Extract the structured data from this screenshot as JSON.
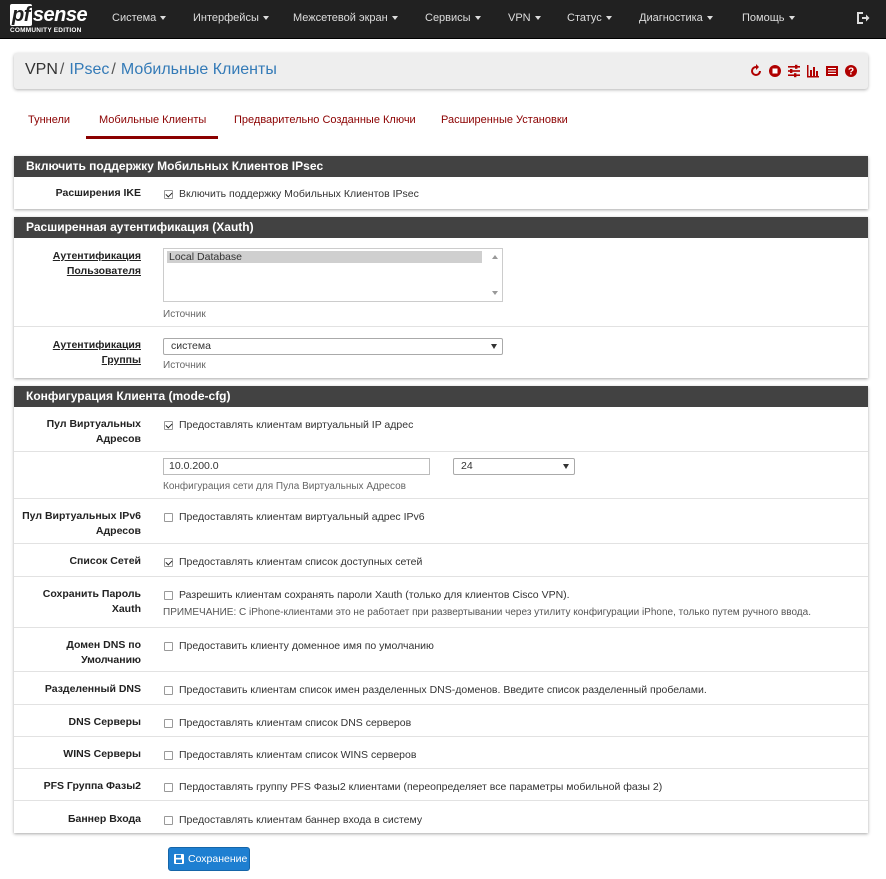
{
  "app": {
    "logo_main": "sense",
    "logo_prefix": "pf",
    "logo_sub": "COMMUNITY EDITION"
  },
  "nav": {
    "items": [
      "Система",
      "Интерфейсы",
      "Межсетевой экран",
      "Сервисы",
      "VPN",
      "Статус",
      "Диагностика",
      "Помощь"
    ]
  },
  "breadcrumb": {
    "root": "VPN",
    "sep": "/",
    "level1": "IPsec",
    "level2": "Мобильные Клиенты"
  },
  "header_icons": [
    "restart-icon",
    "settings-sliders-icon",
    "chart-icon",
    "log-icon",
    "help-icon"
  ],
  "colors": {
    "navbar": "#212121",
    "panel_heading": "#424242",
    "tab_accent": "#8b0000",
    "link": "#337ab7",
    "save_button": "#1e7fd1",
    "header_icon": "#b00000"
  },
  "tabs": {
    "tunnels": "Туннели",
    "mobile": "Мобильные Клиенты",
    "keys": "Предварительно Созданные Ключи",
    "advanced": "Расширенные Установки"
  },
  "section1": {
    "title": "Включить поддержку Мобильных Клиентов IPsec",
    "ike_label": "Расширения IKE",
    "ike_text": "Включить поддержку Мобильных Клиентов IPsec"
  },
  "section2": {
    "title": "Расширенная аутентификация (Xauth)",
    "user_auth_label_1": "Аутентификация",
    "user_auth_label_2": "Пользователя",
    "user_auth_option": "Local Database",
    "user_auth_help": "Источник",
    "group_auth_label_1": "Аутентификация",
    "group_auth_label_2": "Группы",
    "group_auth_value": "система",
    "group_auth_help": "Источник"
  },
  "section3": {
    "title": "Конфигурация Клиента (mode-cfg)",
    "pool_label_1": "Пул Виртуальных",
    "pool_label_2": "Адресов",
    "pool_text": "Предоставлять клиентам виртуальный IP адрес",
    "pool_network": "10.0.200.0",
    "pool_mask": "24",
    "pool_help": "Конфигурация сети для Пула Виртуальных Адресов",
    "pool6_label_1": "Пул Виртуальных IPv6",
    "pool6_label_2": "Адресов",
    "pool6_text": "Предоставлять клиентам виртуальный адрес IPv6",
    "netlist_label": "Список Сетей",
    "netlist_text": "Предоставлять клиентам список доступных сетей",
    "savepass_label": "Сохранить Пароль Xauth",
    "savepass_text": "Разрешить клиентам сохранять пароли Xauth (только для клиентов Cisco VPN).",
    "savepass_note": "ПРИМЕЧАНИЕ: С iPhone-клиентами это не работает при развертывании через утилиту конфигурации iPhone, только путем ручного ввода.",
    "dnsdomain_label_1": "Домен DNS по",
    "dnsdomain_label_2": "Умолчанию",
    "dnsdomain_text": "Предоставить клиенту доменное имя по умолчанию",
    "splitdns_label": "Разделенный DNS",
    "splitdns_text": "Предоставить клиентам список имен разделенных DNS-доменов. Введите список разделенный пробелами.",
    "dns_label": "DNS Серверы",
    "dns_text": "Предоставлять клиентам список DNS серверов",
    "wins_label": "WINS Серверы",
    "wins_text": "Предоставлять клиентам список WINS серверов",
    "pfs_label": "PFS Группа Фазы2",
    "pfs_text": "Пердоставлять группу PFS Фазы2 клиентами (переопределяет все параметры мобильной фазы 2)",
    "banner_label": "Баннер Входа",
    "banner_text": "Предоставлять клиентам баннер входа в систему"
  },
  "save_label": "Сохранение"
}
